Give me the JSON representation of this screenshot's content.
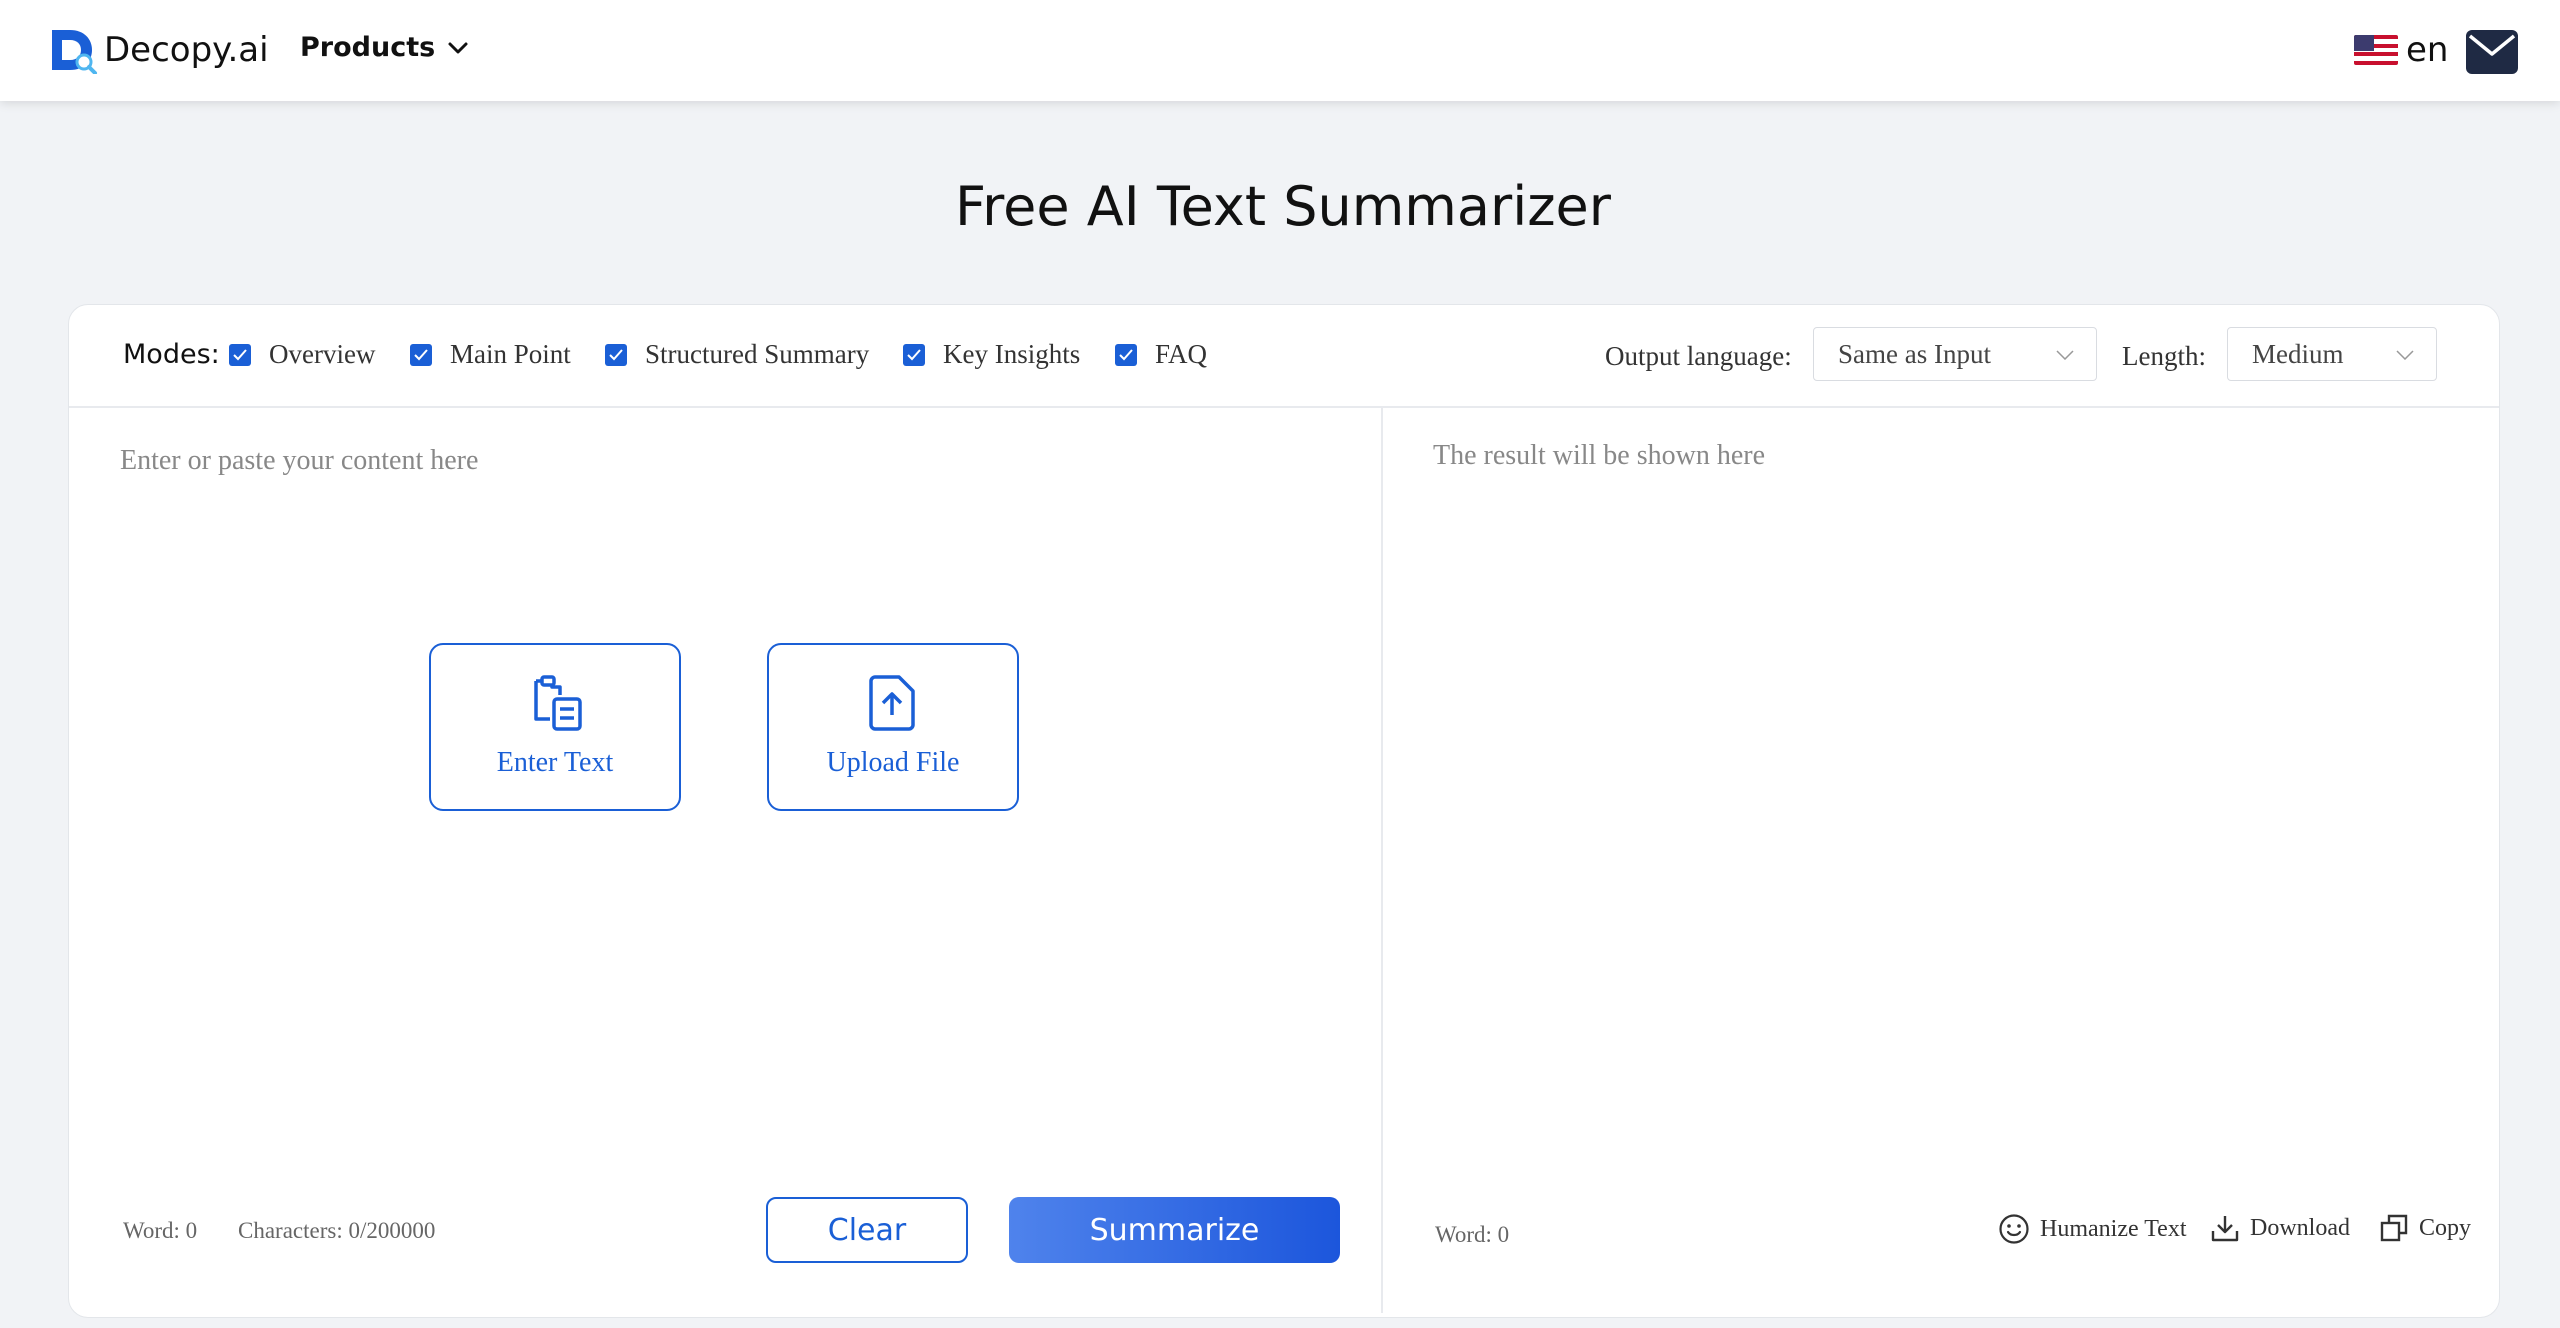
{
  "header": {
    "logo_text": "Decopy.ai",
    "products_label": "Products",
    "language_code": "en"
  },
  "page_title": "Free AI Text Summarizer",
  "toolbar": {
    "modes_label": "Modes:",
    "modes": [
      {
        "label": "Overview",
        "checked": true
      },
      {
        "label": "Main Point",
        "checked": true
      },
      {
        "label": "Structured Summary",
        "checked": true
      },
      {
        "label": "Key Insights",
        "checked": true
      },
      {
        "label": "FAQ",
        "checked": true
      }
    ],
    "output_language_label": "Output language:",
    "output_language_value": "Same as Input",
    "length_label": "Length:",
    "length_value": "Medium"
  },
  "input_panel": {
    "placeholder": "Enter or paste your content here",
    "enter_text_label": "Enter Text",
    "upload_file_label": "Upload File",
    "word_count": "Word: 0",
    "char_count": "Characters: 0/200000",
    "clear_label": "Clear",
    "summarize_label": "Summarize"
  },
  "output_panel": {
    "placeholder": "The result will be shown here",
    "word_count": "Word: 0",
    "humanize_label": "Humanize Text",
    "download_label": "Download",
    "copy_label": "Copy"
  },
  "colors": {
    "accent": "#1a5fd6",
    "background": "#f1f3f6"
  }
}
